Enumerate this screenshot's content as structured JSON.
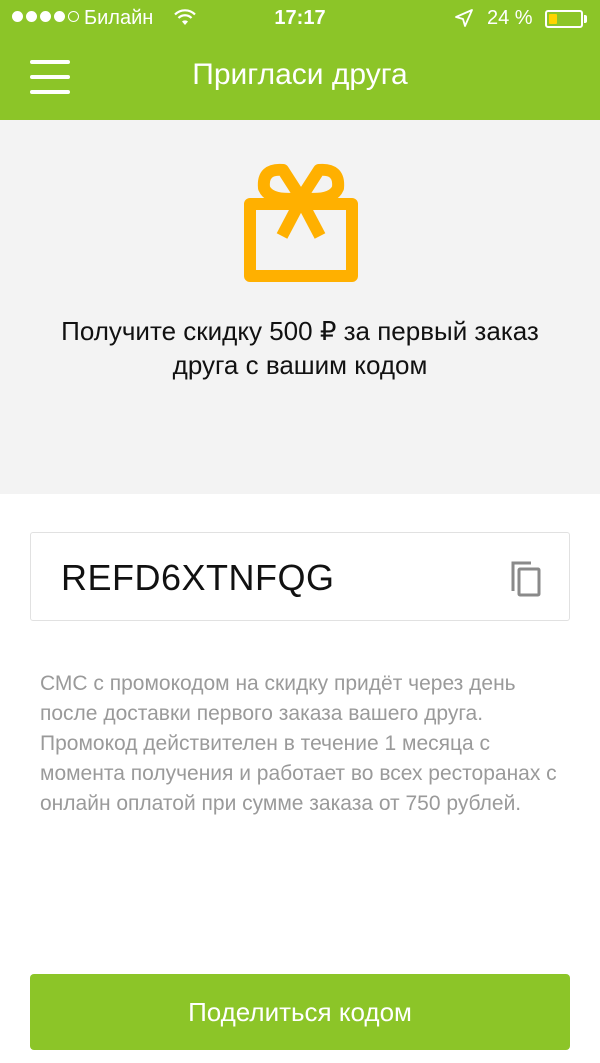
{
  "status_bar": {
    "carrier": "Билайн",
    "time": "17:17",
    "battery": "24 %",
    "battery_level": 0.24
  },
  "header": {
    "title": "Пригласи друга",
    "background_color": "#8cc528"
  },
  "hero": {
    "icon": "gift-icon",
    "icon_color": "#ffb000",
    "promo_line1": "Получите скидку 500 ₽ за первый заказ",
    "promo_line2": "друга с вашим кодом"
  },
  "code_box": {
    "code": "REFD6XTNFQG",
    "copy_icon": "copy-icon"
  },
  "note": "СМС с промокодом на скидку придёт через день после доставки первого заказа вашего друга. Промокод действителен в течение 1 месяца с момента получения и работает во всех ресторанах с онлайн оплатой при сумме заказа от 750 рублей.",
  "share_button": {
    "label": "Поделиться кодом"
  }
}
